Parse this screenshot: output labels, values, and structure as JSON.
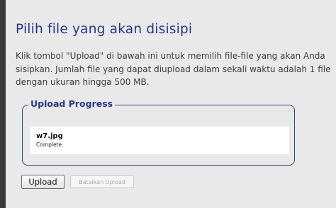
{
  "page": {
    "title": "Pilih file yang akan disisipi",
    "description_lines": [
      "Klik tombol \"Upload\" di bawah ini untuk memilih file-file yang akan Anda",
      "sisipkan. Jumlah file yang dapat diupload dalam sekali waktu adalah 1 file",
      "dengan ukuran hingga 500 MB."
    ]
  },
  "upload_progress": {
    "legend": "Upload Progress",
    "files": [
      {
        "name": "w7.jpg",
        "status": "Complete."
      }
    ]
  },
  "buttons": {
    "upload_label": "Upload",
    "cancel_label": "Batalkan Upload"
  },
  "colors": {
    "background": "#e9e9ea",
    "title": "#253a82",
    "left_bar": "#3a3a3a",
    "fieldset_border": "#31456f"
  }
}
